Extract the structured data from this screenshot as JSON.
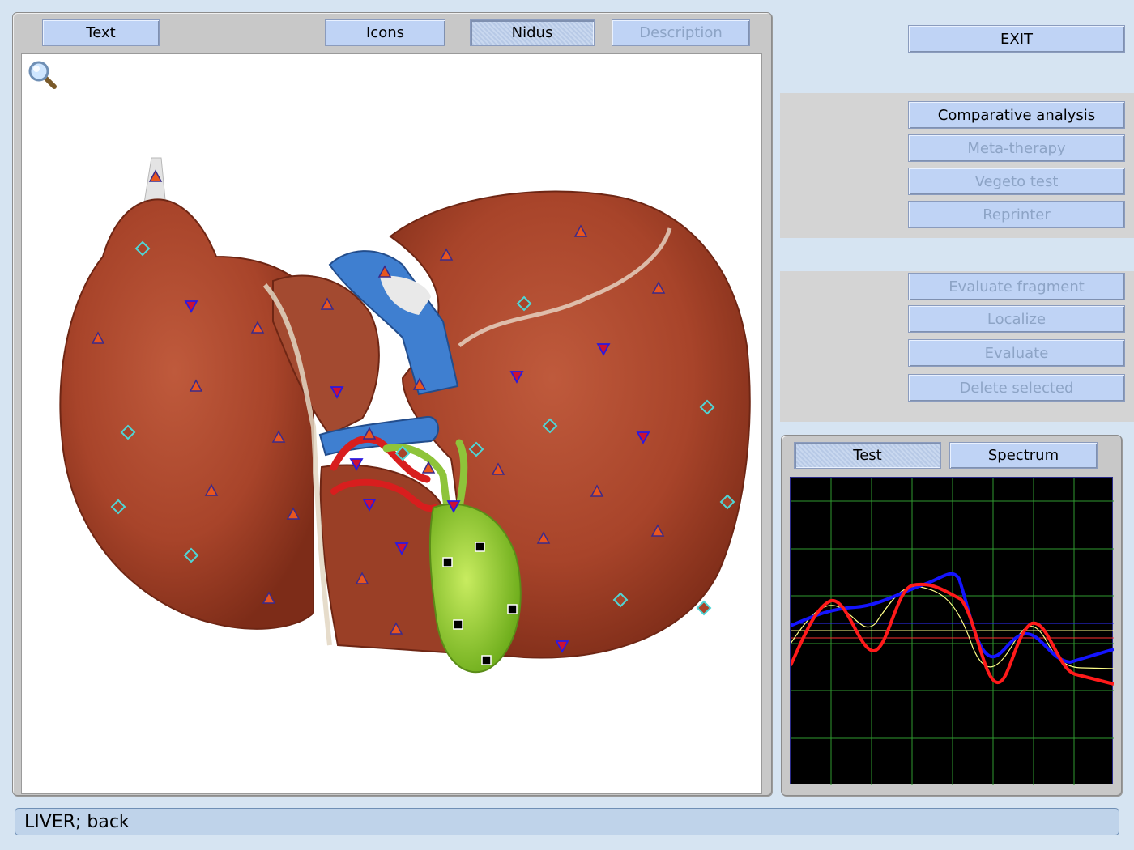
{
  "toolbar": {
    "text_label": "Text",
    "icons_label": "Icons",
    "nidus_label": "Nidus",
    "description_label": "Description"
  },
  "actions": {
    "exit_label": "EXIT",
    "comparative_analysis": "Comparative analysis",
    "meta_therapy": "Meta-therapy",
    "vegeto_test": "Vegeto test",
    "reprinter": "Reprinter",
    "evaluate_fragment": "Evaluate fragment",
    "localize": "Localize",
    "evaluate": "Evaluate",
    "delete_selected": "Delete selected"
  },
  "graph": {
    "test_label": "Test",
    "spectrum_label": "Spectrum"
  },
  "status": {
    "text": "LIVER; back"
  },
  "colors": {
    "liver": "#a8442a",
    "vein": "#3f7fd0",
    "artery": "#d81e1e",
    "gallbladder": "#9ed23a",
    "marker_up": "#e8561f",
    "marker_down": "#cc1133",
    "marker_diamond": "#4fd6d6",
    "trace_blue": "#1414ff",
    "trace_red": "#ff1a1a",
    "trace_yellow": "#ffff88",
    "grid": "#2f9a2f"
  },
  "icons": {
    "zoom": "magnifier-icon"
  }
}
